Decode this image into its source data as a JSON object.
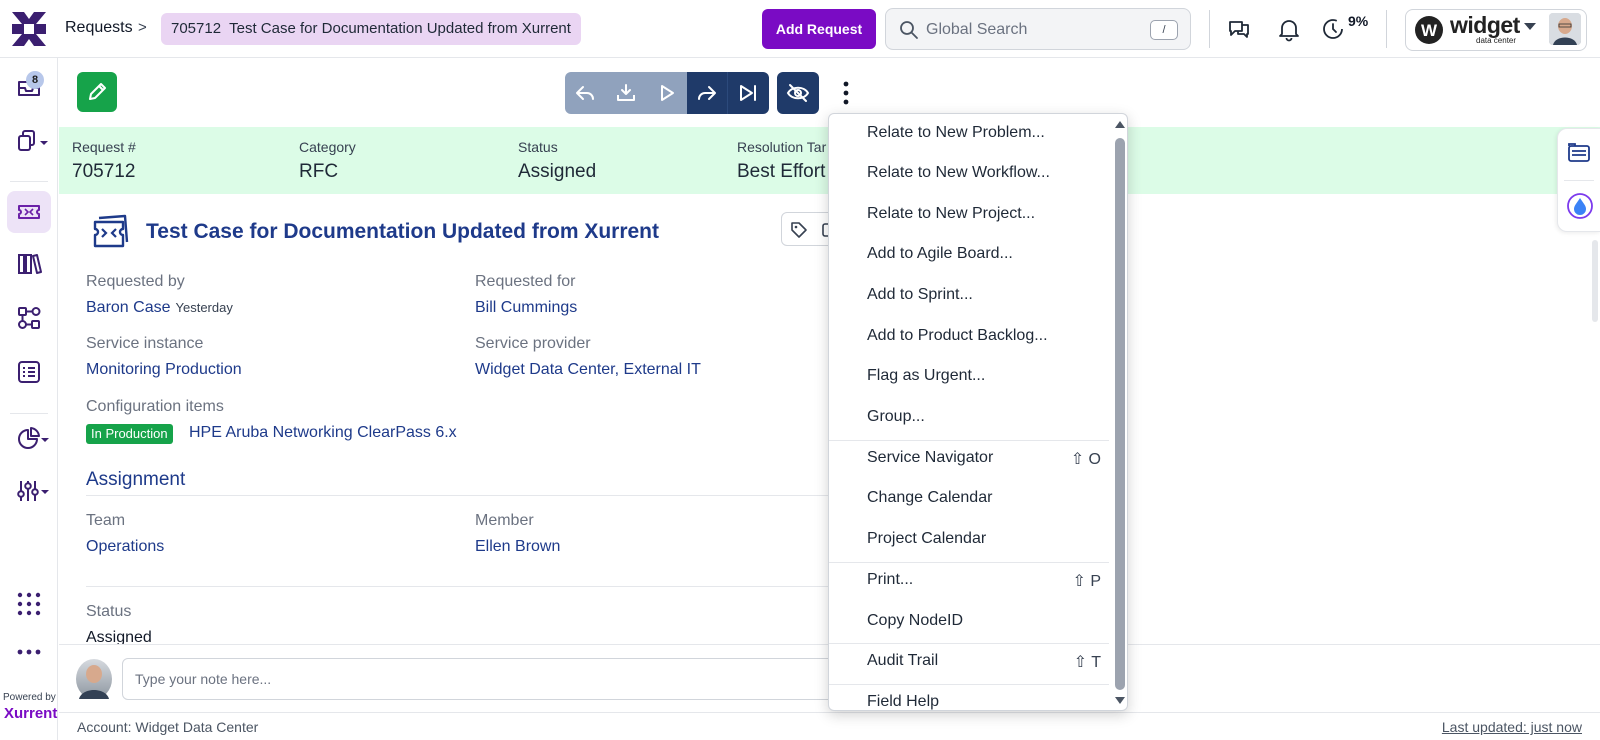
{
  "header": {
    "breadcrumb_root": "Requests",
    "breadcrumb_sep": ">",
    "breadcrumb_current": "705712  Test Case for Documentation Updated from Xurrent",
    "add_request_label": "Add Request",
    "search_placeholder": "Global Search",
    "search_shortcut": "/",
    "progress_percent": "9%",
    "org_name": "widget",
    "org_subtitle": "data center"
  },
  "left_nav": {
    "inbox_count": "8",
    "powered_by": "Powered by",
    "brand": "Xurrent",
    "icons": [
      "inbox-icon",
      "documents-icon",
      "ticket-icon",
      "library-icon",
      "workflow-icon",
      "list-icon",
      "analytics-icon",
      "settings-sliders-icon",
      "apps-grid-icon",
      "more-dots-icon"
    ]
  },
  "summary": {
    "request_label": "Request #",
    "request_value": "705712",
    "category_label": "Category",
    "category_value": "RFC",
    "status_label": "Status",
    "status_value": "Assigned",
    "resolution_label": "Resolution Tar",
    "resolution_value": "Best Effort"
  },
  "request": {
    "title": "Test Case for Documentation Updated from Xurrent",
    "requested_by_label": "Requested by",
    "requested_by": "Baron Case",
    "requested_when": "Yesterday",
    "requested_for_label": "Requested for",
    "requested_for": "Bill Cummings",
    "service_instance_label": "Service instance",
    "service_instance": "Monitoring Production",
    "service_provider_label": "Service provider",
    "service_provider": "Widget Data Center, External IT",
    "ci_label": "Configuration items",
    "ci_badge": "In Production",
    "ci_name": "HPE Aruba Networking ClearPass 6.x",
    "assignment_heading": "Assignment",
    "team_label": "Team",
    "team": "Operations",
    "member_label": "Member",
    "member": "Ellen Brown",
    "status_label": "Status",
    "status": "Assigned"
  },
  "note": {
    "placeholder": "Type your note here..."
  },
  "footer": {
    "account": "Account: Widget Data Center",
    "last_updated": "Last updated: just now"
  },
  "menu": {
    "items": [
      {
        "label": "Relate to New Problem...",
        "shortcut": ""
      },
      {
        "label": "Relate to New Workflow...",
        "shortcut": ""
      },
      {
        "label": "Relate to New Project...",
        "shortcut": ""
      },
      {
        "label": "Add to Agile Board...",
        "shortcut": ""
      },
      {
        "label": "Add to Sprint...",
        "shortcut": ""
      },
      {
        "label": "Add to Product Backlog...",
        "shortcut": ""
      },
      {
        "label": "Flag as Urgent...",
        "shortcut": ""
      },
      {
        "label": "Group...",
        "shortcut": ""
      },
      {
        "label": "Service Navigator",
        "shortcut": "⇧ O"
      },
      {
        "label": "Change Calendar",
        "shortcut": ""
      },
      {
        "label": "Project Calendar",
        "shortcut": ""
      },
      {
        "label": "Print...",
        "shortcut": "⇧ P"
      },
      {
        "label": "Copy NodeID",
        "shortcut": ""
      },
      {
        "label": "Audit Trail",
        "shortcut": "⇧ T"
      },
      {
        "label": "Field Help",
        "shortcut": ""
      }
    ]
  },
  "colors": {
    "brand_purple": "#7a0bc4",
    "navy": "#1e3a8a",
    "summary_green": "#dcfce7",
    "badge_green": "#16a34a"
  }
}
